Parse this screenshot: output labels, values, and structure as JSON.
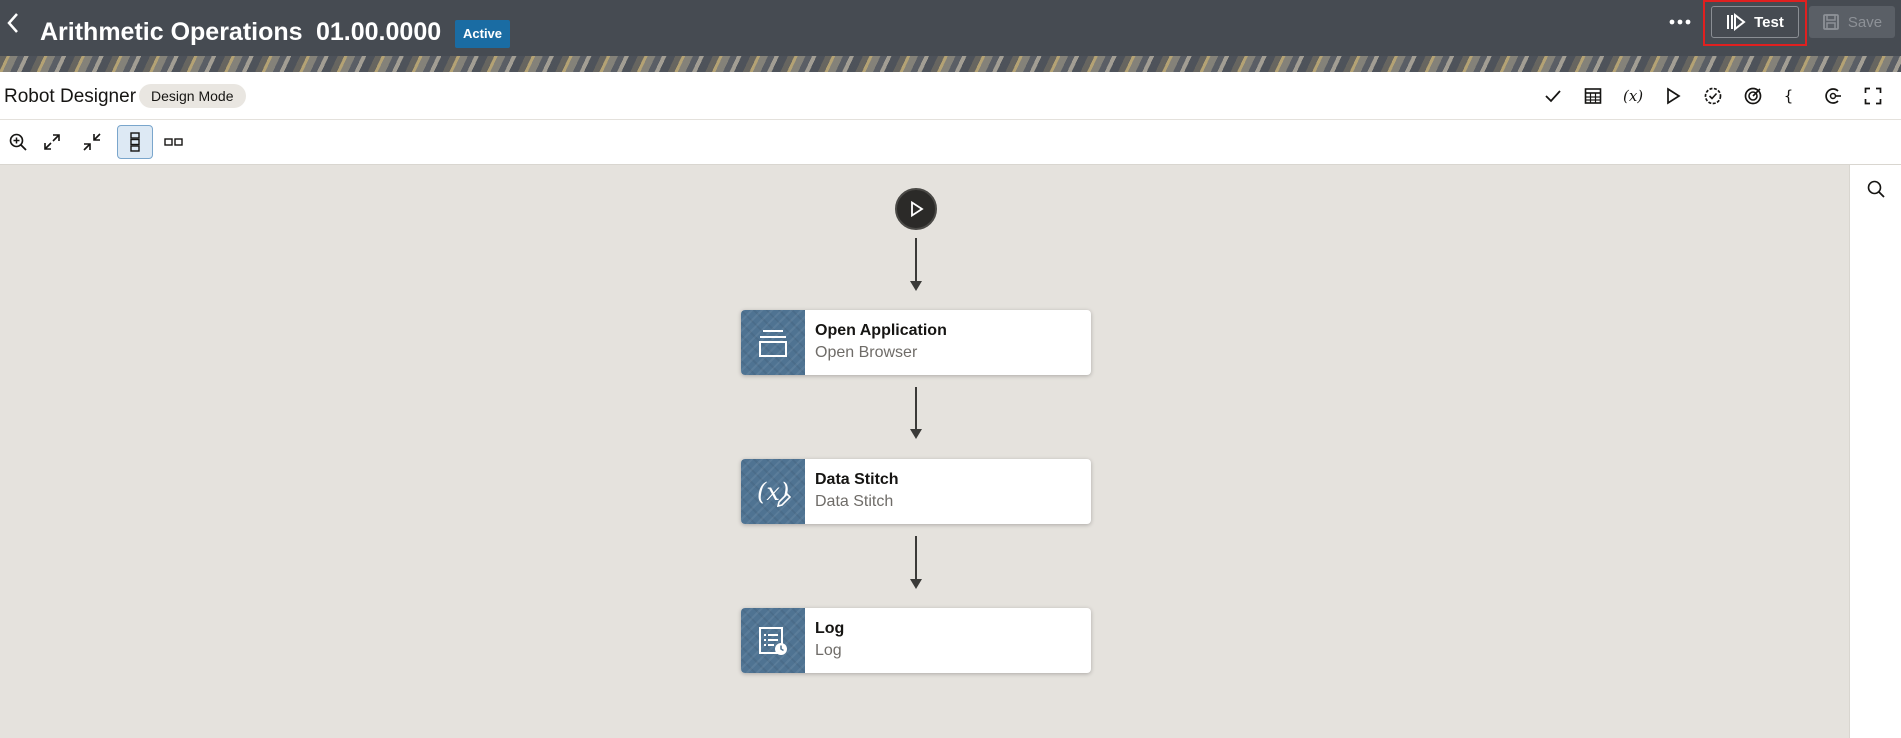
{
  "header": {
    "title": "Arithmetic Operations",
    "version": "01.00.0000",
    "status": "Active",
    "test_label": "Test",
    "save_label": "Save"
  },
  "subheader": {
    "title": "Robot Designer",
    "mode": "Design Mode",
    "tools": [
      "validate-icon",
      "data-table-icon",
      "variables-icon",
      "run-icon",
      "settings-check-icon",
      "target-icon",
      "json-braces-icon",
      "connection-icon",
      "fullscreen-icon"
    ]
  },
  "canvas_toolbar": {
    "tools": [
      "zoom-in-icon",
      "expand-icon",
      "collapse-icon",
      "vertical-layout-icon",
      "horizontal-layout-icon"
    ]
  },
  "flow": {
    "nodes": [
      {
        "title": "Open Application",
        "subtitle": "Open Browser",
        "icon": "application-window-icon"
      },
      {
        "title": "Data Stitch",
        "subtitle": "Data Stitch",
        "icon": "data-stitch-icon"
      },
      {
        "title": "Log",
        "subtitle": "Log",
        "icon": "log-icon"
      }
    ]
  },
  "colors": {
    "header_bg": "#464b52",
    "badge": "#1a6ca3",
    "canvas_bg": "#e5e2dd",
    "node_icon_bg": "#4f7392",
    "highlight": "#e02020"
  }
}
